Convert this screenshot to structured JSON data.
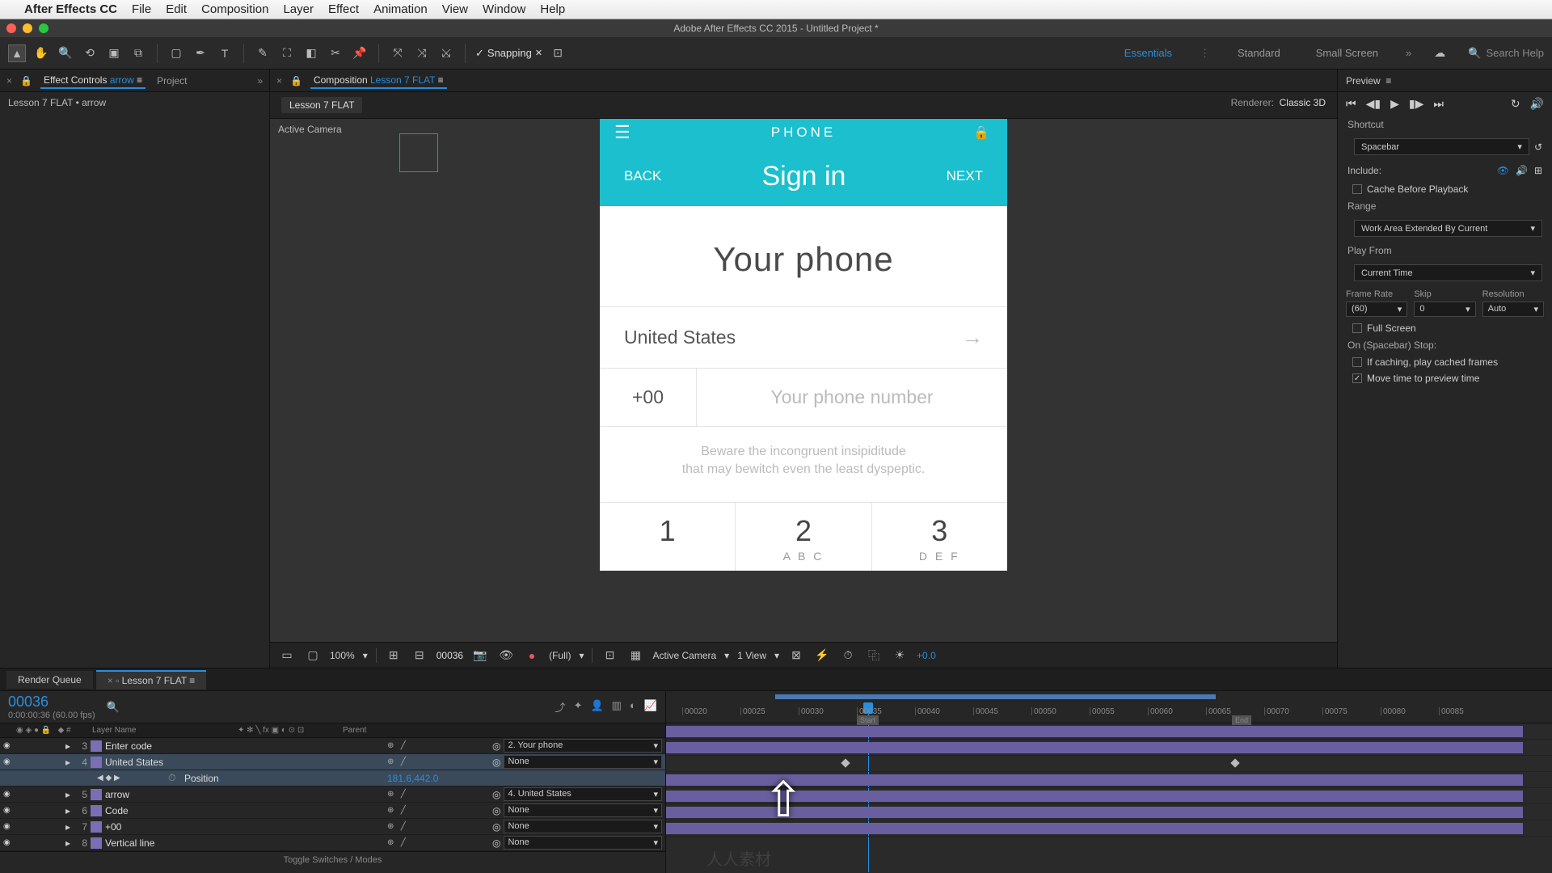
{
  "menubar": {
    "app": "After Effects CC",
    "items": [
      "File",
      "Edit",
      "Composition",
      "Layer",
      "Effect",
      "Animation",
      "View",
      "Window",
      "Help"
    ]
  },
  "titlebar": "Adobe After Effects CC 2015 - Untitled Project *",
  "toolbar": {
    "snapping": "Snapping",
    "workspaces": [
      "Essentials",
      "Standard",
      "Small Screen"
    ],
    "search_ph": "Search Help"
  },
  "effects_panel": {
    "tab_prefix": "Effect Controls ",
    "tab_suffix": "arrow",
    "project": "Project",
    "breadcrumb": "Lesson 7 FLAT • arrow"
  },
  "comp_panel": {
    "tab_prefix": "Composition ",
    "comp_name": "Lesson 7 FLAT",
    "renderer_lbl": "Renderer:",
    "renderer": "Classic 3D",
    "active_camera": "Active Camera"
  },
  "phone": {
    "header": "PHONE",
    "back": "BACK",
    "next": "NEXT",
    "signin": "Sign in",
    "title": "Your phone",
    "country": "United States",
    "code": "+00",
    "placeholder": "Your phone number",
    "blurb1": "Beware the incongruent insipiditude",
    "blurb2": "that may bewitch even the least dyspeptic.",
    "k1n": "1",
    "k1l": "",
    "k2n": "2",
    "k2l": "A B C",
    "k3n": "3",
    "k3l": "D E F"
  },
  "viewer_footer": {
    "zoom": "100%",
    "frame": "00036",
    "res": "(Full)",
    "camera": "Active Camera",
    "view": "1 View",
    "exposure": "+0.0"
  },
  "preview": {
    "title": "Preview",
    "shortcut_lbl": "Shortcut",
    "shortcut": "Spacebar",
    "include": "Include:",
    "cache": "Cache Before Playback",
    "range_lbl": "Range",
    "range": "Work Area Extended By Current",
    "playfrom_lbl": "Play From",
    "playfrom": "Current Time",
    "fr_lbl": "Frame Rate",
    "skip_lbl": "Skip",
    "res_lbl": "Resolution",
    "fr": "(60)",
    "skip": "0",
    "res": "Auto",
    "fullscreen": "Full Screen",
    "stop_lbl": "On (Spacebar) Stop:",
    "stop1": "If caching, play cached frames",
    "stop2": "Move time to preview time"
  },
  "timeline": {
    "render_queue": "Render Queue",
    "comp": "Lesson 7 FLAT",
    "timecode": "00036",
    "fps": "0:00:00:36 (60.00 fps)",
    "hdr_layer": "Layer Name",
    "hdr_parent": "Parent",
    "toggle": "Toggle Switches / Modes",
    "ticks": [
      "00020",
      "00025",
      "00030",
      "00035",
      "00040",
      "00045",
      "00050",
      "00055",
      "00060",
      "00065",
      "00070",
      "00075",
      "00080",
      "00085"
    ],
    "startmark": "Start",
    "endmark": "End",
    "layers": [
      {
        "idx": "3",
        "name": "Enter code",
        "parent": "2. Your phone"
      },
      {
        "idx": "4",
        "name": "United States",
        "parent": "None",
        "selected": true
      },
      {
        "idx": "5",
        "name": "arrow",
        "parent": "4. United States"
      },
      {
        "idx": "6",
        "name": "Code",
        "parent": "None"
      },
      {
        "idx": "7",
        "name": "+00",
        "parent": "None"
      },
      {
        "idx": "8",
        "name": "Vertical line",
        "parent": "None"
      }
    ],
    "prop_name": "Position",
    "prop_value": "181.6,442.0"
  }
}
